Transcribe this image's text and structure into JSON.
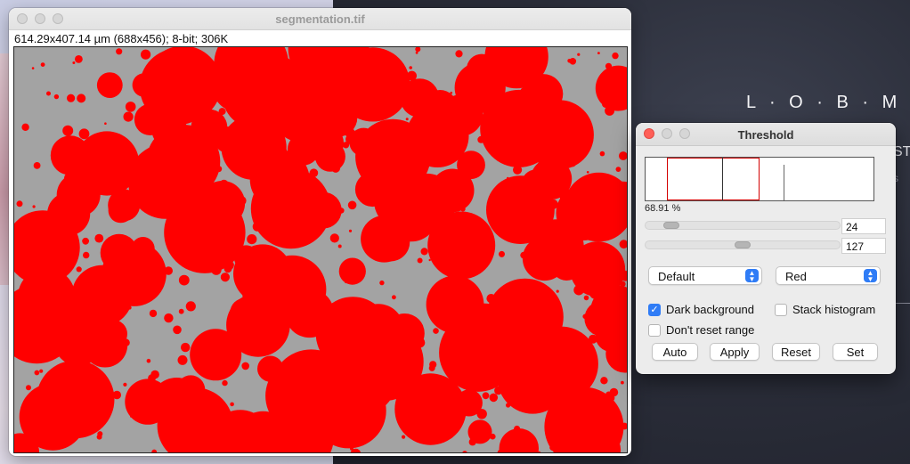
{
  "image_window": {
    "title": "segmentation.tif",
    "info": "614.29x407.14 µm (688x456); 8-bit; 306K"
  },
  "threshold_window": {
    "title": "Threshold",
    "percent": "68.91 %",
    "min_value": "24",
    "max_value": "127",
    "method": "Default",
    "display_mode": "Red",
    "dark_background_label": "Dark background",
    "dark_background_checked": true,
    "stack_histogram_label": "Stack histogram",
    "stack_histogram_checked": false,
    "dont_reset_label": "Don't reset range",
    "dont_reset_checked": false,
    "buttons": {
      "auto": "Auto",
      "apply": "Apply",
      "reset": "Reset",
      "set": "Set"
    }
  },
  "desktop": {
    "logo_text": "L · O · B · M",
    "fragment_st": "ST",
    "fragment_s": "s"
  },
  "colors": {
    "overlay_red": "#ff0000",
    "background_gray": "#a3a3a3",
    "accent_blue": "#2f7cf6"
  }
}
